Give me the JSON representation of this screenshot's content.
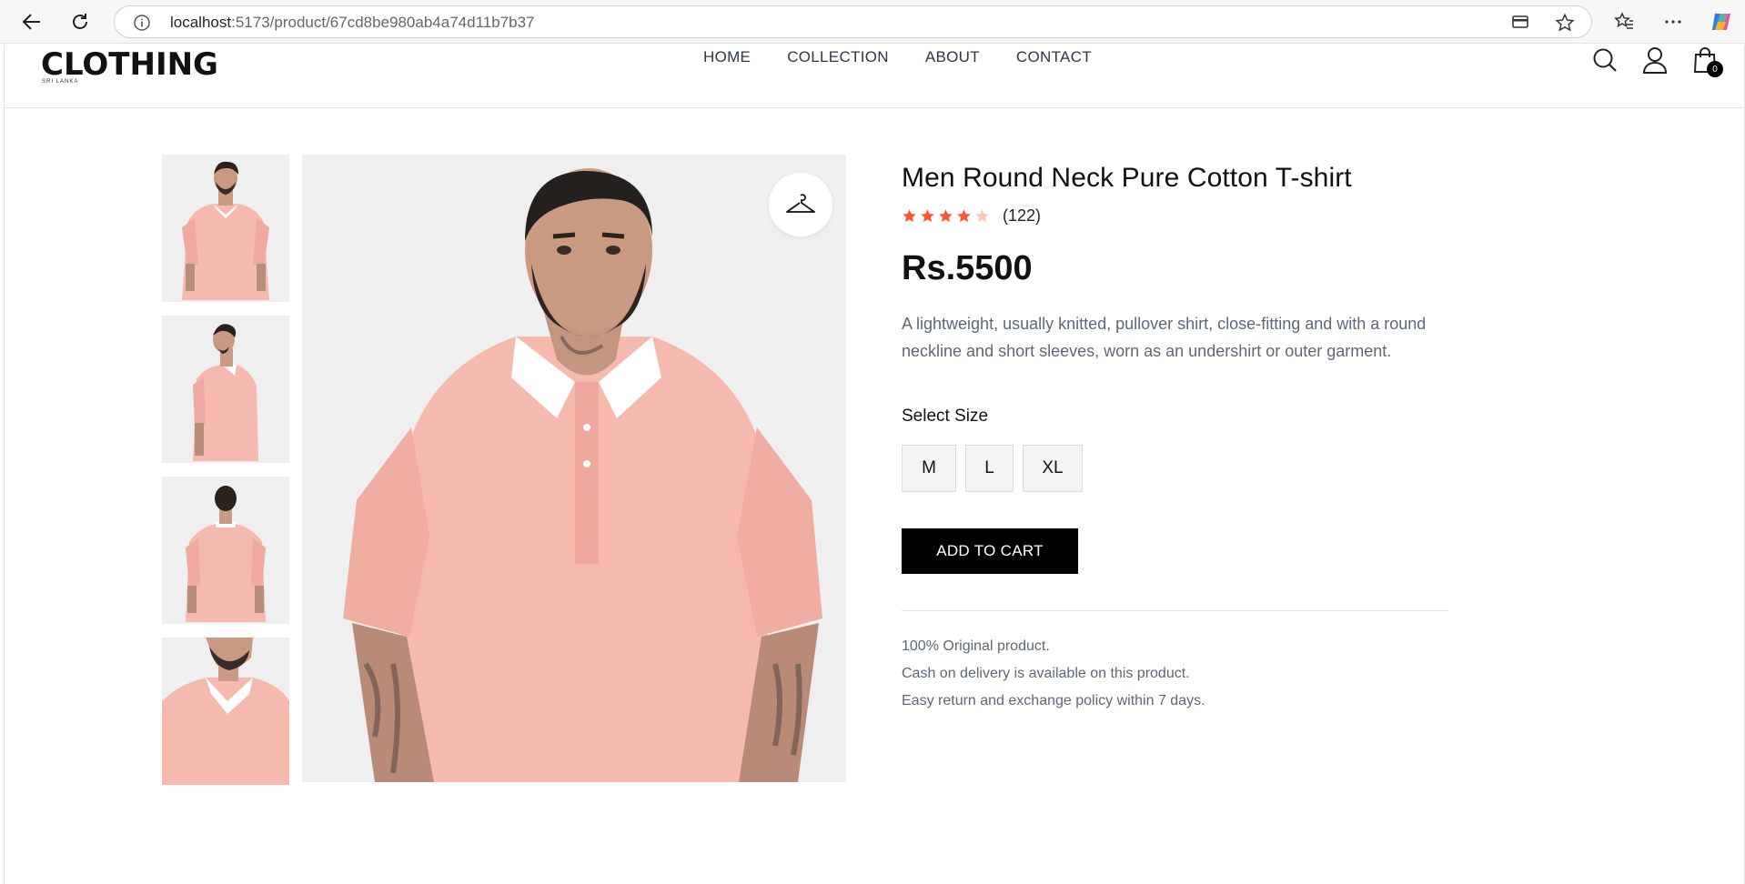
{
  "browser": {
    "url_host": "localhost",
    "url_path": ":5173/product/67cd8be980ab4a74d11b7b37"
  },
  "site": {
    "logo_text": "CLOTHING",
    "logo_sub": "SRI LANKA",
    "nav": [
      "HOME",
      "COLLECTION",
      "ABOUT",
      "CONTACT"
    ],
    "cart_count": "0"
  },
  "product": {
    "title": "Men Round Neck Pure Cotton T-shirt",
    "rating_value": 4,
    "rating_max": 5,
    "review_count": "(122)",
    "price": "Rs.5500",
    "description": "A lightweight, usually knitted, pullover shirt, close-fitting and with a round neckline and short sleeves, worn as an undershirt or outer garment.",
    "size_label": "Select Size",
    "sizes": [
      "M",
      "L",
      "XL"
    ],
    "add_to_cart": "ADD TO CART",
    "notes": [
      "100% Original product.",
      "Cash on delivery is available on this product.",
      "Easy return and exchange policy within 7 days."
    ]
  },
  "colors": {
    "star_filled": "#ff532e",
    "star_empty": "#fbc5b8",
    "shirt": "#f5b9ae",
    "button_bg": "#000000"
  },
  "icons": [
    "back-arrow-icon",
    "reload-icon",
    "info-icon",
    "card-icon",
    "star-outline-icon",
    "favorites-icon",
    "more-icon",
    "copilot-icon",
    "search-icon",
    "user-icon",
    "bag-icon",
    "hanger-icon"
  ]
}
